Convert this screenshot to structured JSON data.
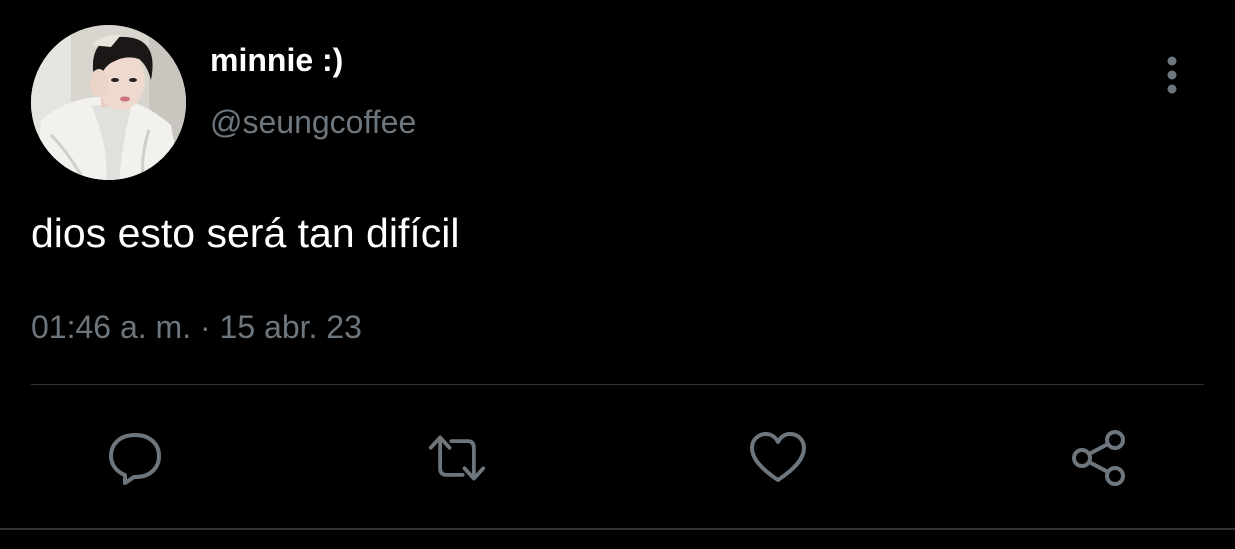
{
  "author": {
    "display_name": "minnie :)",
    "handle": "@seungcoffee",
    "avatar_icon": "profile-photo"
  },
  "tweet": {
    "text": "dios esto será tan difícil",
    "timestamp": "01:46 a. m. · 15 abr. 23"
  },
  "actions": [
    {
      "name": "reply",
      "icon": "speech-bubble-icon"
    },
    {
      "name": "retweet",
      "icon": "retweet-arrows-icon"
    },
    {
      "name": "like",
      "icon": "heart-icon"
    },
    {
      "name": "share",
      "icon": "share-nodes-icon"
    }
  ],
  "menu": {
    "icon": "vertical-dots-icon"
  },
  "colors": {
    "background": "#000000",
    "primary_text": "#ffffff",
    "secondary_text": "#6e767d",
    "icon": "#6e767d",
    "divider": "#2f3336"
  }
}
